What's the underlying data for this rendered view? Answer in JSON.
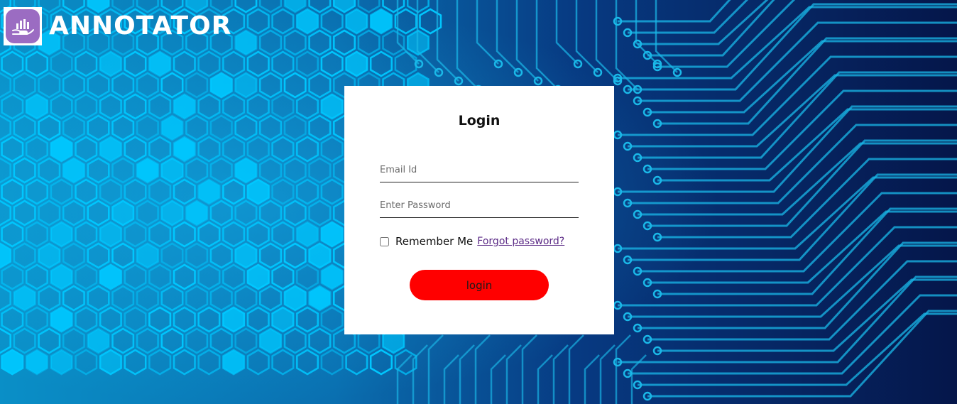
{
  "brand": {
    "name": "ANNOTATOR",
    "logo_icon": "chart-hand-icon",
    "logo_color": "#9b6cc2"
  },
  "background": {
    "description_icon": "circuit-hexagon-background",
    "colors": {
      "dark": "#061a4a",
      "hex_glow": "#00c8ff",
      "trace": "#1ab8e8"
    }
  },
  "login_form": {
    "title": "Login",
    "email": {
      "placeholder": "Email Id",
      "value": ""
    },
    "password": {
      "placeholder": "Enter Password",
      "value": ""
    },
    "remember_me": {
      "label": "Remember Me",
      "checked": false
    },
    "forgot_password_label": "Forgot password?",
    "submit_label": "login",
    "submit_color": "#ff0000"
  }
}
